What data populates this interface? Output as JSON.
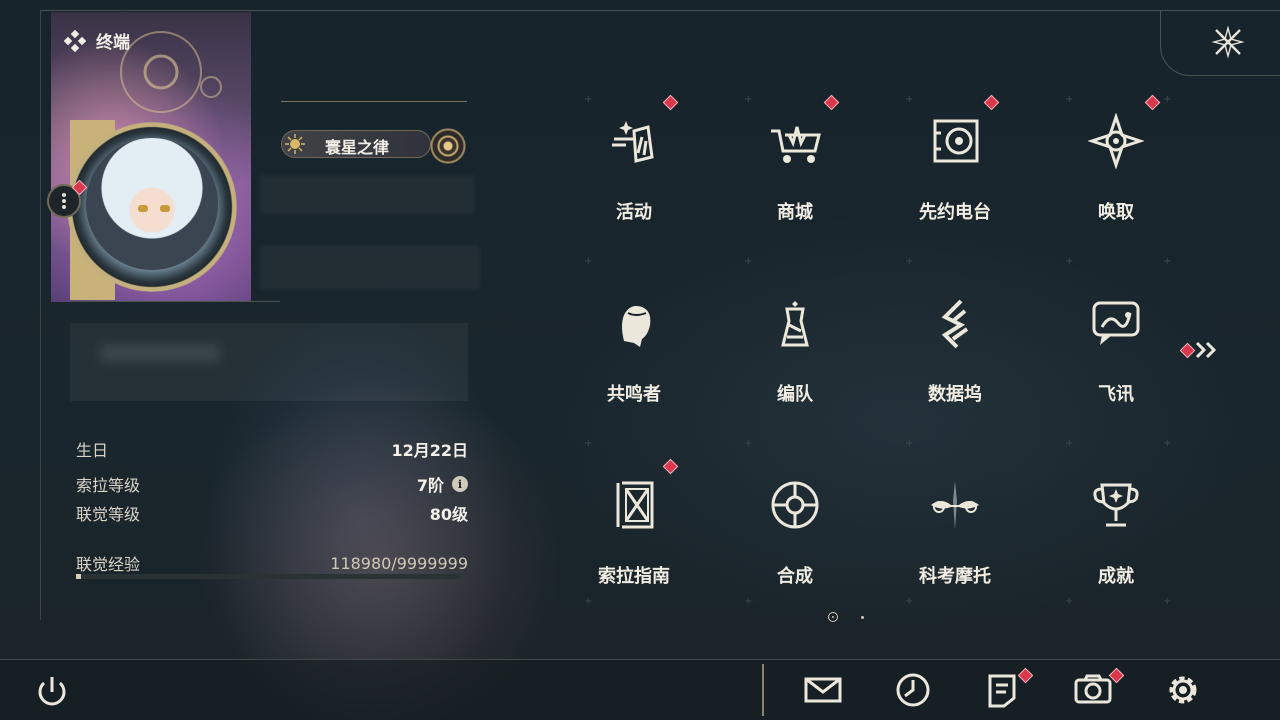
{
  "header": {
    "title": "终端"
  },
  "profile": {
    "title_badge": "寰星之律",
    "stats": [
      {
        "label": "生日",
        "value": "12月22日"
      },
      {
        "label": "索拉等级",
        "value": "7阶"
      },
      {
        "label": "联觉等级",
        "value": "80级"
      }
    ],
    "exp": {
      "label": "联觉经验",
      "value": "118980/9999999",
      "progress": 0.012
    }
  },
  "menu": {
    "items": [
      {
        "label": "活动",
        "icon": "activity-icon",
        "badge": true
      },
      {
        "label": "商城",
        "icon": "shop-cart-icon",
        "badge": true
      },
      {
        "label": "先约电台",
        "icon": "radio-icon",
        "badge": true
      },
      {
        "label": "唤取",
        "icon": "summon-compass-icon",
        "badge": true
      },
      {
        "label": "共鸣者",
        "icon": "resonator-icon",
        "badge": false
      },
      {
        "label": "编队",
        "icon": "team-chess-icon",
        "badge": false
      },
      {
        "label": "数据坞",
        "icon": "data-bank-icon",
        "badge": false
      },
      {
        "label": "飞讯",
        "icon": "message-icon",
        "badge": false
      },
      {
        "label": "索拉指南",
        "icon": "guide-book-icon",
        "badge": true
      },
      {
        "label": "合成",
        "icon": "synthesis-icon",
        "badge": false
      },
      {
        "label": "科考摩托",
        "icon": "motorcycle-icon",
        "badge": false
      },
      {
        "label": "成就",
        "icon": "trophy-icon",
        "badge": false
      }
    ]
  },
  "colors": {
    "badge_red": "#d9384c",
    "accent_gold": "#c8b27a",
    "text": "#f1ede3"
  }
}
